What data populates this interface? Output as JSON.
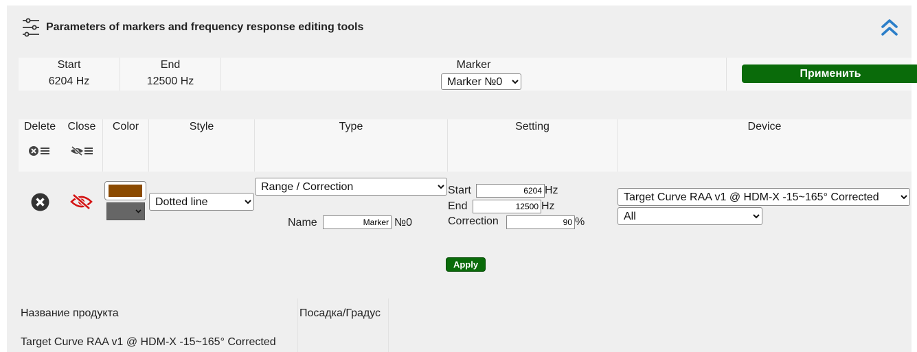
{
  "header": {
    "title": "Parameters of markers and frequency response editing tools",
    "icon": "sliders-icon",
    "collapse_icon": "double-chevron-up-icon"
  },
  "topbar": {
    "start_label": "Start",
    "start_value": "6204 Hz",
    "end_label": "End",
    "end_value": "12500 Hz",
    "marker_label": "Marker",
    "marker_selected": "Marker №0",
    "apply_ru": "Применить",
    "accent": "#0a6b0a"
  },
  "columns": {
    "delete": "Delete",
    "close": "Close",
    "color": "Color",
    "style": "Style",
    "type": "Type",
    "setting": "Setting",
    "device": "Device"
  },
  "row": {
    "marker_color": "#8b4a00",
    "line_color": "#666666",
    "close_color": "#d41414",
    "style_selected": "Dotted line",
    "type_selected": "Range / Correction",
    "name_label": "Name",
    "name_value": "Marker",
    "name_suffix": "№0",
    "start_label": "Start",
    "start_value": "6204",
    "start_unit": "Hz",
    "end_label": "End",
    "end_value": "12500",
    "end_unit": "Hz",
    "correction_label": "Correction",
    "correction_value": "90",
    "correction_unit": "%",
    "device_selected": "Target Curve RAA v1 @ HDM-X -15~165° Corrected",
    "channel_selected": "All"
  },
  "apply_en": "Apply",
  "products": {
    "col1_header": "Название продукта",
    "col2_header": "Посадка/Градус",
    "rows": [
      {
        "name": "Target Curve RAA v1 @ HDM-X -15~165° Corrected",
        "fit": ""
      }
    ]
  }
}
